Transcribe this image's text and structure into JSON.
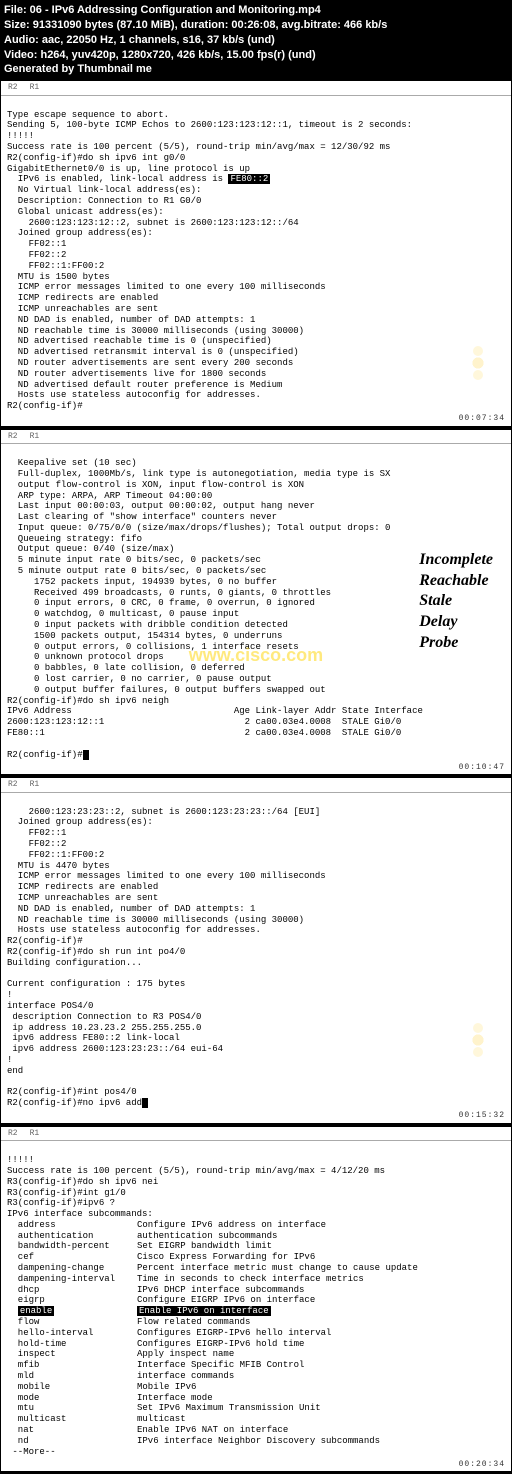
{
  "header": {
    "file": "File: 06 - IPv6 Addressing Configuration and Monitoring.mp4",
    "size": "Size: 91331090 bytes (87.10 MiB), duration: 00:26:08, avg.bitrate: 466 kb/s",
    "audio": "Audio: aac, 22050 Hz, 1 channels, s16, 37 kb/s (und)",
    "video": "Video: h264, yuv420p, 1280x720, 426 kb/s, 15.00 fps(r) (und)",
    "gen": "Generated by Thumbnail me"
  },
  "tabs": {
    "t1": "R2",
    "t2": "R1"
  },
  "panel1": {
    "l1": "Type escape sequence to abort.",
    "l2": "Sending 5, 100-byte ICMP Echos to 2600:123:123:12::1, timeout is 2 seconds:",
    "l3": "!!!!!",
    "l4": "Success rate is 100 percent (5/5), round-trip min/avg/max = 12/30/92 ms",
    "l5": "R2(config-if)#do sh ipv6 int g0/0",
    "l6": "GigabitEthernet0/0 is up, line protocol is up",
    "l7a": "  IPv6 is enabled, link-local address is ",
    "l7b": "FE80::2",
    "l8": "  No Virtual link-local address(es):",
    "l9": "  Description: Connection to R1 G0/0",
    "l10": "  Global unicast address(es):",
    "l11": "    2600:123:123:12::2, subnet is 2600:123:123:12::/64",
    "l12": "  Joined group address(es):",
    "l13": "    FF02::1",
    "l14": "    FF02::2",
    "l15": "    FF02::1:FF00:2",
    "l16": "  MTU is 1500 bytes",
    "l17": "  ICMP error messages limited to one every 100 milliseconds",
    "l18": "  ICMP redirects are enabled",
    "l19": "  ICMP unreachables are sent",
    "l20": "  ND DAD is enabled, number of DAD attempts: 1",
    "l21": "  ND reachable time is 30000 milliseconds (using 30000)",
    "l22": "  ND advertised reachable time is 0 (unspecified)",
    "l23": "  ND advertised retransmit interval is 0 (unspecified)",
    "l24": "  ND router advertisements are sent every 200 seconds",
    "l25": "  ND router advertisements live for 1800 seconds",
    "l26": "  ND advertised default router preference is Medium",
    "l27": "  Hosts use stateless autoconfig for addresses.",
    "l28": "R2(config-if)#",
    "ts": "00:07:34"
  },
  "panel2": {
    "l1": "  Keepalive set (10 sec)",
    "l2": "  Full-duplex, 1000Mb/s, link type is autonegotiation, media type is SX",
    "l3": "  output flow-control is XON, input flow-control is XON",
    "l4": "  ARP type: ARPA, ARP Timeout 04:00:00",
    "l5": "  Last input 00:00:03, output 00:00:02, output hang never",
    "l6": "  Last clearing of \"show interface\" counters never",
    "l7": "  Input queue: 0/75/0/0 (size/max/drops/flushes); Total output drops: 0",
    "l8": "  Queueing strategy: fifo",
    "l9": "  Output queue: 0/40 (size/max)",
    "l10": "  5 minute input rate 0 bits/sec, 0 packets/sec",
    "l11": "  5 minute output rate 0 bits/sec, 0 packets/sec",
    "l12": "     1752 packets input, 194939 bytes, 0 no buffer",
    "l13": "     Received 499 broadcasts, 0 runts, 0 giants, 0 throttles",
    "l14": "     0 input errors, 0 CRC, 0 frame, 0 overrun, 0 ignored",
    "l15": "     0 watchdog, 0 multicast, 0 pause input",
    "l16": "     0 input packets with dribble condition detected",
    "l17": "     1500 packets output, 154314 bytes, 0 underruns",
    "l18": "     0 output errors, 0 collisions, 1 interface resets",
    "l19": "     0 unknown protocol drops",
    "l20": "     0 babbles, 0 late collision, 0 deferred",
    "l21": "     0 lost carrier, 0 no carrier, 0 pause output",
    "l22": "     0 output buffer failures, 0 output buffers swapped out",
    "l23": "R2(config-if)#do sh ipv6 neigh",
    "l24": "IPv6 Address                              Age Link-layer Addr State Interface",
    "l25": "2600:123:123:12::1                          2 ca00.03e4.0008  STALE Gi0/0",
    "l26": "FE80::1                                     2 ca00.03e4.0008  STALE Gi0/0",
    "l27": "",
    "l28": "R2(config-if)#",
    "ts": "00:10:47",
    "annotations": [
      "Incomplete",
      "Reachable",
      "Stale",
      "Delay",
      "Probe"
    ],
    "watermark": "www.cisco.com"
  },
  "panel3": {
    "l1": "    2600:123:23:23::2, subnet is 2600:123:23:23::/64 [EUI]",
    "l2": "  Joined group address(es):",
    "l3": "    FF02::1",
    "l4": "    FF02::2",
    "l5": "    FF02::1:FF00:2",
    "l6": "  MTU is 4470 bytes",
    "l7": "  ICMP error messages limited to one every 100 milliseconds",
    "l8": "  ICMP redirects are enabled",
    "l9": "  ICMP unreachables are sent",
    "l10": "  ND DAD is enabled, number of DAD attempts: 1",
    "l11": "  ND reachable time is 30000 milliseconds (using 30000)",
    "l12": "  Hosts use stateless autoconfig for addresses.",
    "l13": "R2(config-if)#",
    "l14": "R2(config-if)#do sh run int po4/0",
    "l15": "Building configuration...",
    "l16": "",
    "l17": "Current configuration : 175 bytes",
    "l18": "!",
    "l19": "interface POS4/0",
    "l20": " description Connection to R3 POS4/0",
    "l21": " ip address 10.23.23.2 255.255.255.0",
    "l22": " ipv6 address FE80::2 link-local",
    "l23": " ipv6 address 2600:123:23:23::/64 eui-64",
    "l24": "!",
    "l25": "end",
    "l26": "",
    "l27": "R2(config-if)#int pos4/0",
    "l28": "R2(config-if)#no ipv6 add",
    "ts": "00:15:32"
  },
  "panel4": {
    "l1": "!!!!!",
    "l2": "Success rate is 100 percent (5/5), round-trip min/avg/max = 4/12/20 ms",
    "l3": "R3(config-if)#do sh ipv6 nei",
    "l4": "R3(config-if)#int g1/0",
    "l5": "R3(config-if)#ipv6 ?",
    "l6": "IPv6 interface subcommands:",
    "cmds": [
      {
        "c": "address",
        "d": "Configure IPv6 address on interface"
      },
      {
        "c": "authentication",
        "d": "authentication subcommands"
      },
      {
        "c": "bandwidth-percent",
        "d": "Set EIGRP bandwidth limit"
      },
      {
        "c": "cef",
        "d": "Cisco Express Forwarding for IPv6"
      },
      {
        "c": "dampening-change",
        "d": "Percent interface metric must change to cause update"
      },
      {
        "c": "dampening-interval",
        "d": "Time in seconds to check interface metrics"
      },
      {
        "c": "dhcp",
        "d": "IPv6 DHCP interface subcommands"
      },
      {
        "c": "eigrp",
        "d": "Configure EIGRP IPv6 on interface"
      },
      {
        "c": "enable",
        "d": "Enable IPv6 on interface",
        "hl": true
      },
      {
        "c": "flow",
        "d": "Flow related commands"
      },
      {
        "c": "hello-interval",
        "d": "Configures EIGRP-IPv6 hello interval"
      },
      {
        "c": "hold-time",
        "d": "Configures EIGRP-IPv6 hold time"
      },
      {
        "c": "inspect",
        "d": "Apply inspect name"
      },
      {
        "c": "mfib",
        "d": "Interface Specific MFIB Control"
      },
      {
        "c": "mld",
        "d": "interface commands"
      },
      {
        "c": "mobile",
        "d": "Mobile IPv6"
      },
      {
        "c": "mode",
        "d": "Interface mode"
      },
      {
        "c": "mtu",
        "d": "Set IPv6 Maximum Transmission Unit"
      },
      {
        "c": "multicast",
        "d": "multicast"
      },
      {
        "c": "nat",
        "d": "Enable IPv6 NAT on interface"
      },
      {
        "c": "nd",
        "d": "IPv6 interface Neighbor Discovery subcommands"
      }
    ],
    "more": " --More--",
    "ts": "00:20:34"
  }
}
